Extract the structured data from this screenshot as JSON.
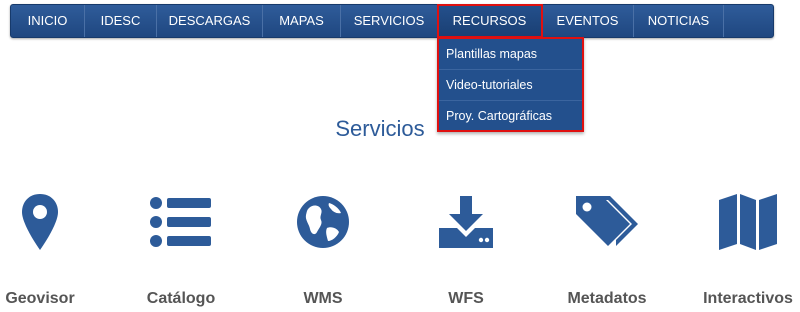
{
  "nav": {
    "items": [
      {
        "label": "INICIO"
      },
      {
        "label": "IDESC"
      },
      {
        "label": "DESCARGAS"
      },
      {
        "label": "MAPAS"
      },
      {
        "label": "SERVICIOS"
      },
      {
        "label": "RECURSOS"
      },
      {
        "label": "EVENTOS"
      },
      {
        "label": "NOTICIAS"
      }
    ],
    "active": "RECURSOS"
  },
  "dropdown": {
    "items": [
      {
        "label": "Plantillas mapas"
      },
      {
        "label": "Video-tutoriales"
      },
      {
        "label": "Proy. Cartográficas"
      }
    ]
  },
  "section": {
    "title": "Servicios"
  },
  "services": [
    {
      "label": "Geovisor",
      "icon": "map-marker-icon"
    },
    {
      "label": "Catálogo",
      "icon": "list-icon"
    },
    {
      "label": "WMS",
      "icon": "globe-icon"
    },
    {
      "label": "WFS",
      "icon": "download-icon"
    },
    {
      "label": "Metadatos",
      "icon": "tags-icon"
    },
    {
      "label": "Interactivos",
      "icon": "map-icon"
    }
  ],
  "colors": {
    "nav_bg": "#2a5592",
    "highlight": "#e01010",
    "icon": "#2d5b99",
    "label": "#555555"
  }
}
